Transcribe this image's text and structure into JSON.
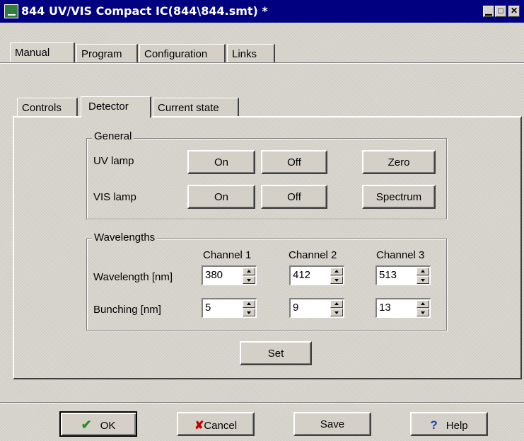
{
  "window": {
    "title": "844 UV/VIS Compact IC(844\\844.smt) *",
    "min_glyph": "▁",
    "max_glyph": "□",
    "close_glyph": "✕"
  },
  "main_tabs": [
    "Manual",
    "Program",
    "Configuration",
    "Links"
  ],
  "sub_tabs": [
    "Controls",
    "Detector",
    "Current state"
  ],
  "active_sub_tab": "Detector",
  "general": {
    "title": "General",
    "uv_label": "UV lamp",
    "vis_label": "VIS lamp",
    "on_label": "On",
    "off_label": "Off",
    "zero_label": "Zero",
    "spectrum_label": "Spectrum"
  },
  "wavelengths": {
    "title": "Wavelengths",
    "channels": [
      "Channel 1",
      "Channel 2",
      "Channel 3"
    ],
    "wavelength_label": "Wavelength [nm]",
    "bunching_label": "Bunching [nm]",
    "wavelength_values": [
      "380",
      "412",
      "513"
    ],
    "bunching_values": [
      "5",
      "9",
      "13"
    ]
  },
  "set_label": "Set",
  "footer": {
    "ok_label": "OK",
    "cancel_label": "Cancel",
    "save_label": "Save",
    "help_label": "Help",
    "ok_icon": "✔",
    "cancel_icon": "✘",
    "help_icon": "?"
  },
  "colors": {
    "titlebar": "#000080",
    "ok_icon": "#2e8b22",
    "cancel_icon": "#c00000",
    "help_icon": "#1a3fb0"
  }
}
